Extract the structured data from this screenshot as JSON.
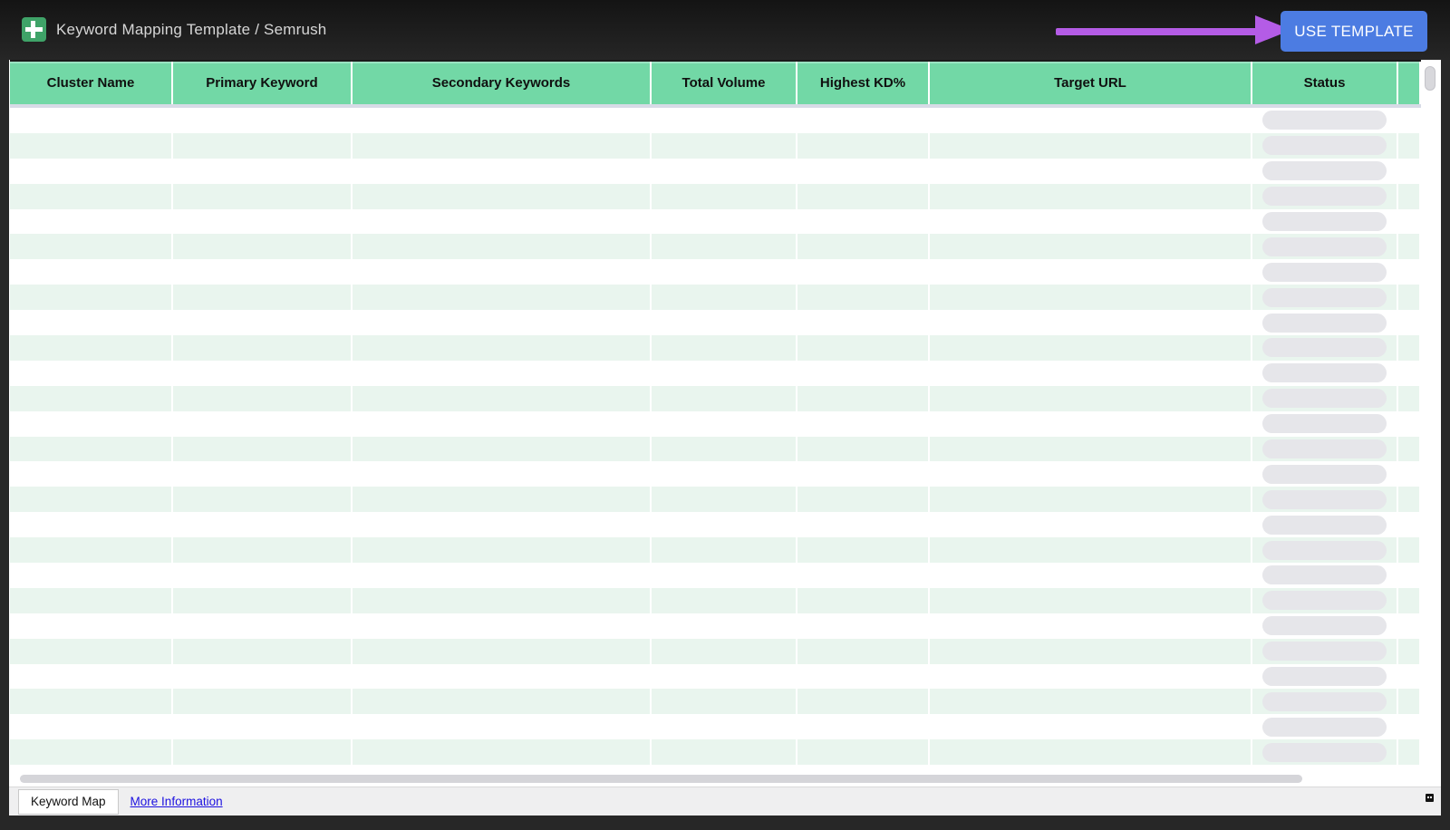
{
  "header": {
    "title": "Keyword Mapping Template / Semrush",
    "use_template_button": "USE TEMPLATE"
  },
  "table": {
    "columns": [
      "Cluster Name",
      "Primary Keyword",
      "Secondary Keywords",
      "Total Volume",
      "Highest KD%",
      "Target URL",
      "Status"
    ],
    "row_count": 26,
    "rows_empty": true
  },
  "footer": {
    "tab_label": "Keyword Map",
    "link_label": "More Information"
  },
  "colors": {
    "header_green": "#72d8a6",
    "row_alt_green": "#e9f5ee",
    "button_blue": "#4c7ce2",
    "arrow_purple": "#b45ce6",
    "link_blue": "#1c10e0",
    "status_pill_gray": "#e6e6ea",
    "sheets_icon_green": "#3fa368"
  }
}
